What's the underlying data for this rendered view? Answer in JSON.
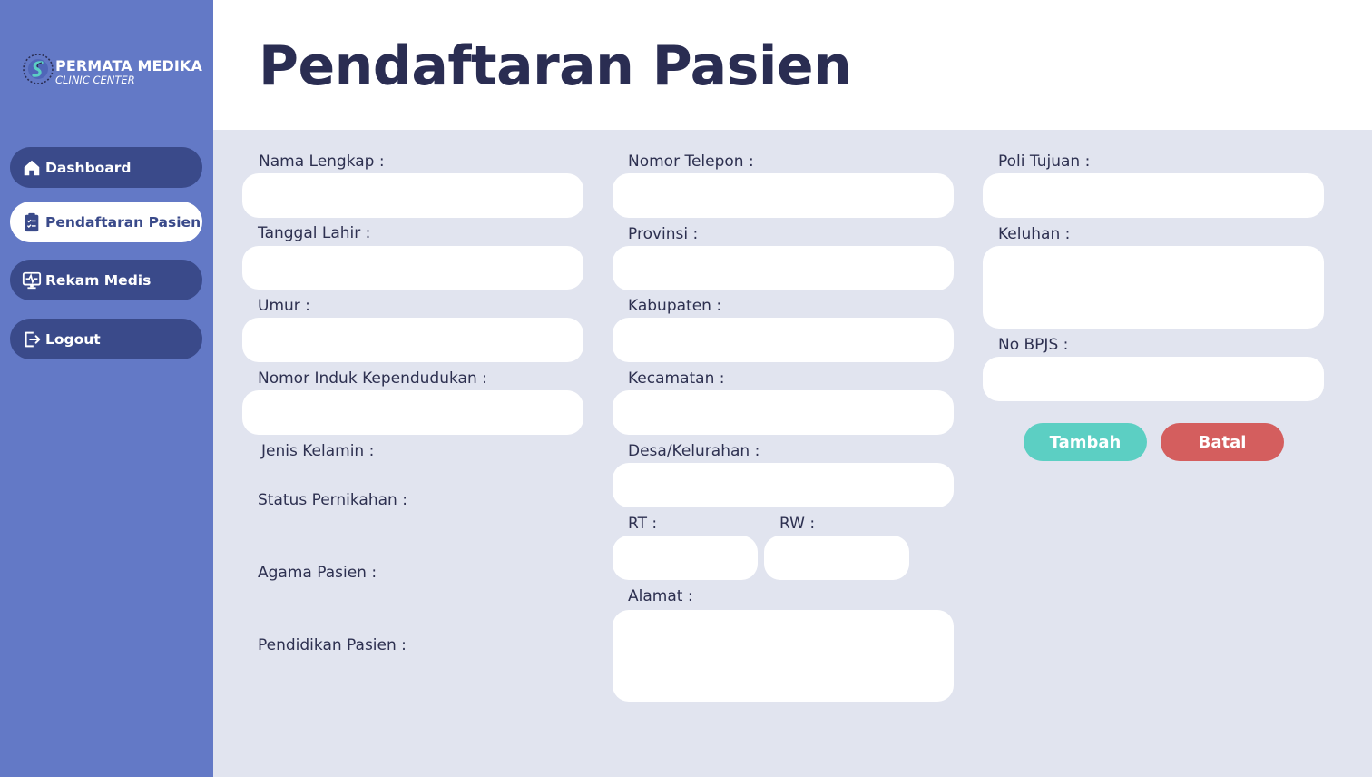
{
  "brand": {
    "name": "PERMATA MEDIKA",
    "subtitle": "CLINIC CENTER"
  },
  "sidebar": {
    "items": [
      {
        "label": "Dashboard",
        "icon": "home-icon",
        "active": false
      },
      {
        "label": "Pendaftaran Pasien",
        "icon": "clipboard-list-icon",
        "active": true
      },
      {
        "label": "Rekam Medis",
        "icon": "monitor-heartbeat-icon",
        "active": false
      },
      {
        "label": "Logout",
        "icon": "logout-icon",
        "active": false
      }
    ]
  },
  "page": {
    "title": "Pendaftaran Pasien"
  },
  "form": {
    "nama_lengkap": {
      "label": "Nama Lengkap :",
      "value": ""
    },
    "tanggal_lahir": {
      "label": "Tanggal Lahir :",
      "value": ""
    },
    "umur": {
      "label": "Umur :",
      "value": ""
    },
    "nik": {
      "label": "Nomor Induk Kependudukan :",
      "value": ""
    },
    "jenis_kelamin": {
      "label": "Jenis Kelamin :"
    },
    "status_pernikahan": {
      "label": "Status Pernikahan :"
    },
    "agama": {
      "label": "Agama Pasien :"
    },
    "pendidikan": {
      "label": "Pendidikan Pasien :"
    },
    "nomor_telepon": {
      "label": "Nomor Telepon :",
      "value": ""
    },
    "provinsi": {
      "label": "Provinsi :",
      "value": ""
    },
    "kabupaten": {
      "label": "Kabupaten :",
      "value": ""
    },
    "kecamatan": {
      "label": "Kecamatan :",
      "value": ""
    },
    "desa": {
      "label": "Desa/Kelurahan :",
      "value": ""
    },
    "rt": {
      "label": "RT :",
      "value": ""
    },
    "rw": {
      "label": "RW :",
      "value": ""
    },
    "alamat": {
      "label": "Alamat :",
      "value": ""
    },
    "poli_tujuan": {
      "label": "Poli Tujuan :",
      "value": ""
    },
    "keluhan": {
      "label": "Keluhan :",
      "value": ""
    },
    "no_bpjs": {
      "label": "No BPJS :",
      "value": ""
    }
  },
  "actions": {
    "add_label": "Tambah",
    "cancel_label": "Batal"
  },
  "colors": {
    "sidebar": "#6379c6",
    "nav_item": "#3a4a8a",
    "background": "#e1e4ef",
    "title": "#2a2d52",
    "add_button": "#5ccfc3",
    "cancel_button": "#d45e5e"
  }
}
